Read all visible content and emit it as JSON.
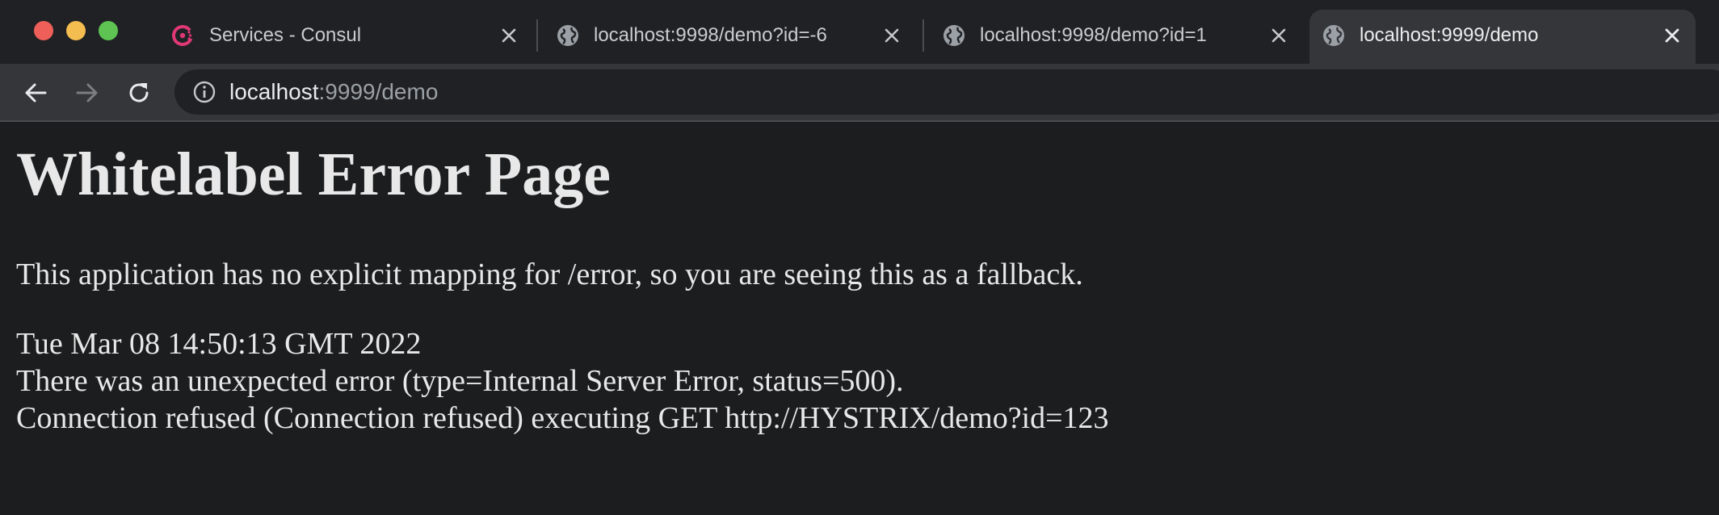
{
  "browser": {
    "tabs": [
      {
        "title": "Services - Consul",
        "icon": "consul-logo-icon",
        "active": false
      },
      {
        "title": "localhost:9998/demo?id=-6",
        "icon": "globe-icon",
        "active": false
      },
      {
        "title": "localhost:9998/demo?id=1",
        "icon": "globe-icon",
        "active": false
      },
      {
        "title": "localhost:9999/demo",
        "icon": "globe-icon",
        "active": true
      }
    ],
    "address_bar": {
      "host": "localhost",
      "rest": ":9999/demo",
      "icon": "info-icon"
    },
    "colors": {
      "tabstrip": "#202124",
      "active_tab": "#35363a",
      "consul_accent": "#e03875",
      "traffic_red": "#ed5f58",
      "traffic_yellow": "#f4bd4f",
      "traffic_green": "#5ec353"
    }
  },
  "page": {
    "heading": "Whitelabel Error Page",
    "message": "This application has no explicit mapping for /error, so you are seeing this as a fallback.",
    "timestamp": "Tue Mar 08 14:50:13 GMT 2022",
    "error_line": "There was an unexpected error (type=Internal Server Error, status=500).",
    "detail_line": "Connection refused (Connection refused) executing GET http://HYSTRIX/demo?id=123"
  }
}
